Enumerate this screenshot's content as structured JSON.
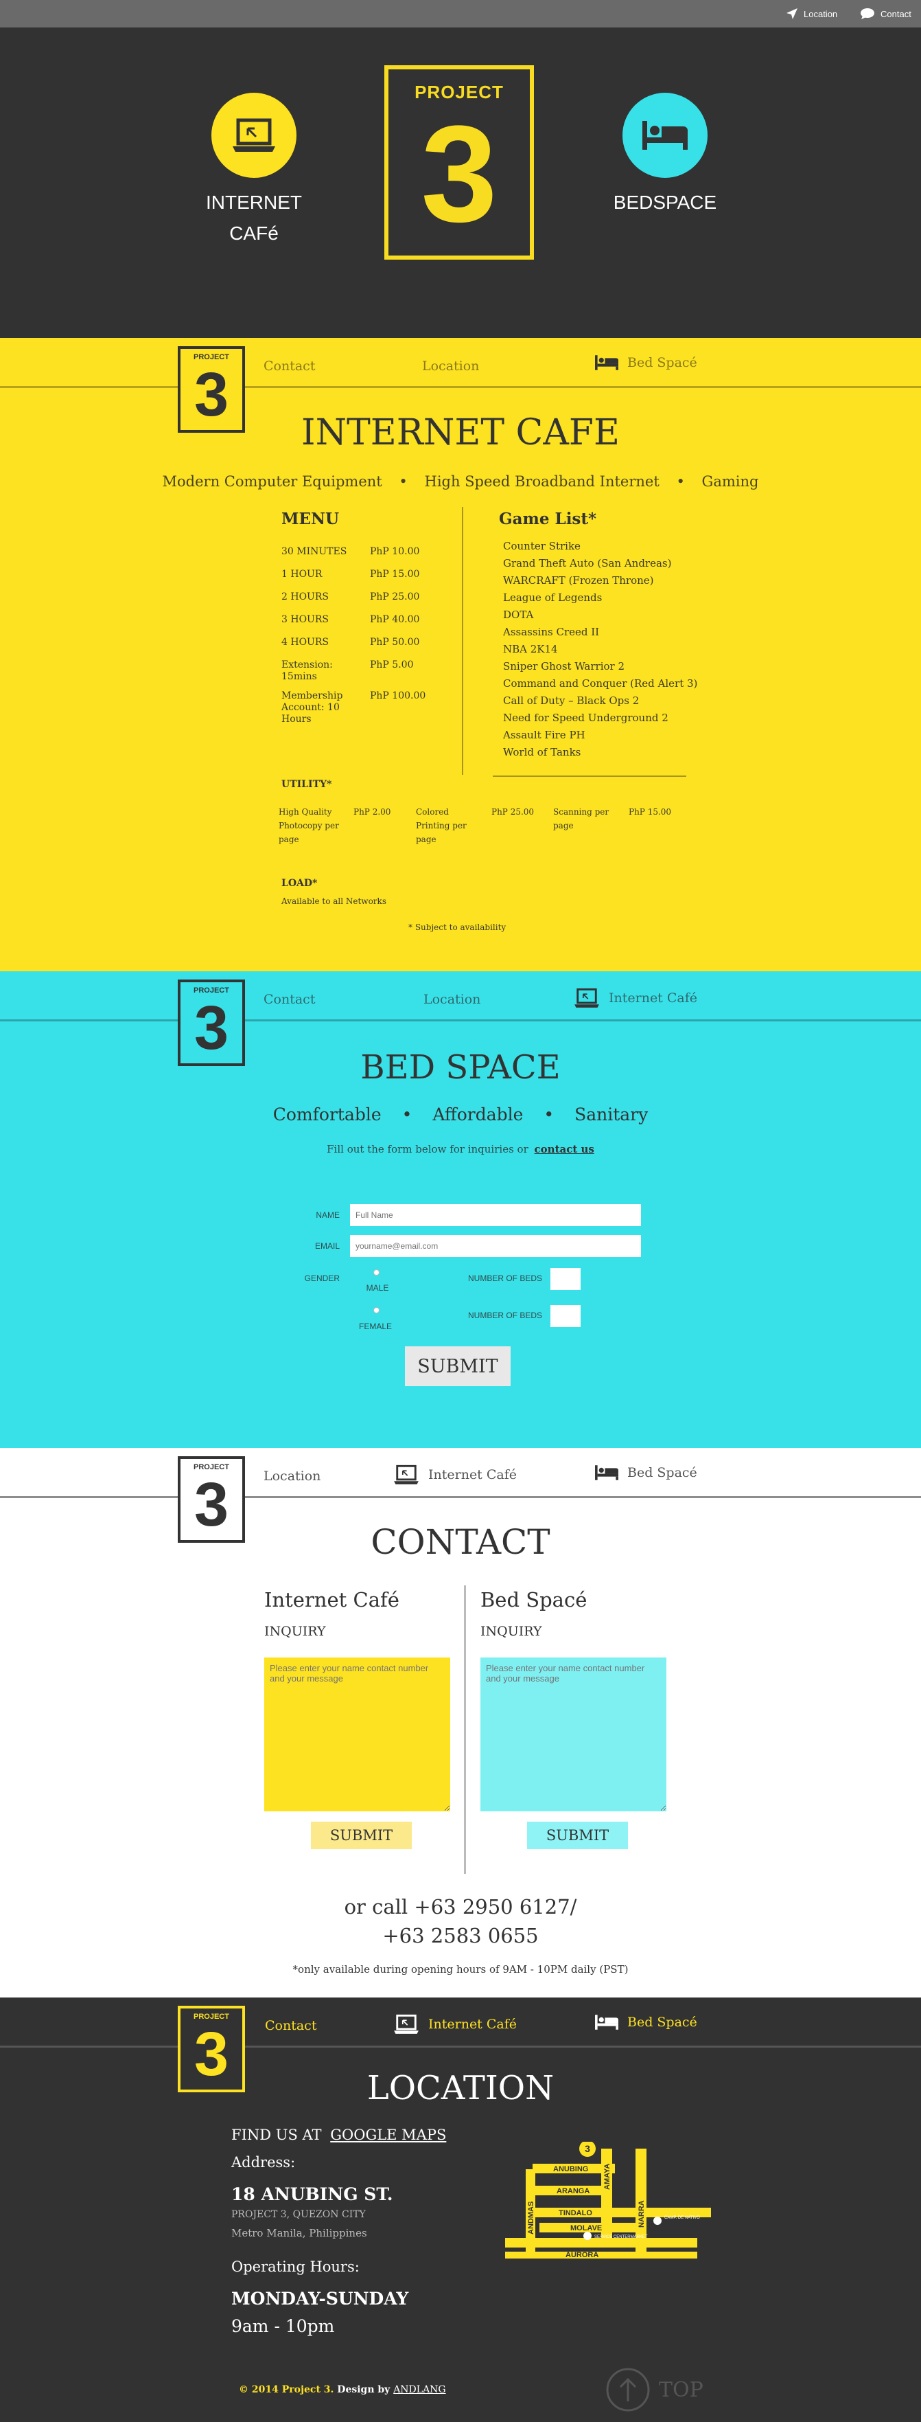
{
  "topbar": {
    "location": "Location",
    "contact": "Contact"
  },
  "hero": {
    "internet_line1": "INTERNET",
    "internet_line2": "CAFé",
    "logo_project": "PROJECT",
    "logo_number": "3",
    "bedspace": "BEDSPACE"
  },
  "logo": {
    "project": "PROJECT",
    "number": "3"
  },
  "cafe_nav": {
    "contact": "Contact",
    "location": "Location",
    "bedspace": "Bed Spacé"
  },
  "cafe": {
    "title": "INTERNET CAFE",
    "features": [
      "Modern Computer Equipment",
      "High Speed Broadband Internet",
      "Gaming"
    ],
    "bullet": "•",
    "menu_title": "MENU",
    "menu": [
      {
        "item": "30 MINUTES",
        "price": "PhP 10.00"
      },
      {
        "item": "1 HOUR",
        "price": "PhP 15.00"
      },
      {
        "item": "2 HOURS",
        "price": "PhP 25.00"
      },
      {
        "item": "3 HOURS",
        "price": "PhP 40.00"
      },
      {
        "item": "4 HOURS",
        "price": "PhP 50.00"
      },
      {
        "item": "Extension: 15mins",
        "price": "PhP 5.00"
      },
      {
        "item": "Membership Account: 10 Hours",
        "price": "PhP 100.00"
      }
    ],
    "games_title": "Game List*",
    "games": [
      "Counter Strike",
      "Grand Theft Auto (San Andreas)",
      "WARCRAFT (Frozen Throne)",
      "League of Legends",
      "DOTA",
      "Assassins Creed II",
      "NBA 2K14",
      "Sniper Ghost Warrior 2",
      "Command and Conquer (Red Alert 3)",
      "Call of Duty – Black Ops 2",
      "Need for Speed Underground 2",
      "Assault Fire PH",
      "World of Tanks"
    ],
    "utility_title": "UTILITY*",
    "utility": [
      {
        "item": "High Quality Photocopy per page",
        "price": "PhP 2.00"
      },
      {
        "item": "Colored Printing per page",
        "price": "PhP 25.00"
      },
      {
        "item": "Scanning per page",
        "price": "PhP 15.00"
      }
    ],
    "load_title": "LOAD*",
    "load_text": "Available to all Networks",
    "note": "* Subject to availability"
  },
  "bed_nav": {
    "contact": "Contact",
    "location": "Location",
    "internet": "Internet Café"
  },
  "bed": {
    "title": "BED SPACE",
    "features": [
      "Comfortable",
      "Affordable",
      "Sanitary"
    ],
    "bullet": "•",
    "intro": "Fill out the form below for inquiries or",
    "intro_link": "contact us",
    "name_label": "NAME",
    "name_placeholder": "Full Name",
    "email_label": "EMAIL",
    "email_placeholder": "yourname@email.com",
    "gender_label": "GENDER",
    "male": "MALE",
    "female": "FEMALE",
    "beds_label_1": "NUMBER OF BEDS",
    "beds_label_2": "NUMBER OF BEDS",
    "submit": "SUBMIT"
  },
  "contact_nav": {
    "location": "Location",
    "internet": "Internet Café",
    "bedspace": "Bed Spacé"
  },
  "contact": {
    "title": "CONTACT",
    "left_title": "Internet Café",
    "left_sub": "INQUIRY",
    "left_placeholder": "Please enter your name contact number and your message",
    "left_submit": "SUBMIT",
    "right_title": "Bed Spacé",
    "right_sub": "INQUIRY",
    "right_placeholder": "Please enter your name contact number and your message",
    "right_submit": "SUBMIT",
    "call_line1": "or call +63 2950 6127/",
    "call_line2": "+63 2583 0655",
    "hours_note": "*only available during opening hours of 9AM - 10PM daily (PST)"
  },
  "loc_nav": {
    "contact": "Contact",
    "internet": "Internet Café",
    "bedspace": "Bed Spacé"
  },
  "location": {
    "title": "LOCATION",
    "find_prefix": "FIND US AT",
    "find_link": "GOOGLE MAPS",
    "address_label": "Address:",
    "street": "18 ANUBING ST.",
    "line2": "PROJECT 3, QUEZON CITY",
    "line3": "Metro Manila, Philippines",
    "hours_label": "Operating Hours:",
    "days": "MONDAY-SUNDAY",
    "hours": "9am - 10pm",
    "map_labels": {
      "anubing": "ANUBING",
      "aranga": "ARANGA",
      "tindalo": "TINDALO",
      "molave": "MOLAVE",
      "aurora": "AURORA",
      "amaya": "AMAYA",
      "andmas": "ANDMAS",
      "narra": "NARRA",
      "pin": "3",
      "landmark1": "CAMP. DE NATIVO",
      "landmark2": "SERVICE CENTERMARKET"
    }
  },
  "footer": {
    "copyright": "© 2014 Project 3.",
    "design_by": "Design by",
    "designer": "ANDLANG",
    "top": "TOP"
  },
  "colors": {
    "yellow": "#fde221",
    "cyan": "#38e1e8",
    "dark": "#333232",
    "topbar": "#6a6a6a"
  }
}
